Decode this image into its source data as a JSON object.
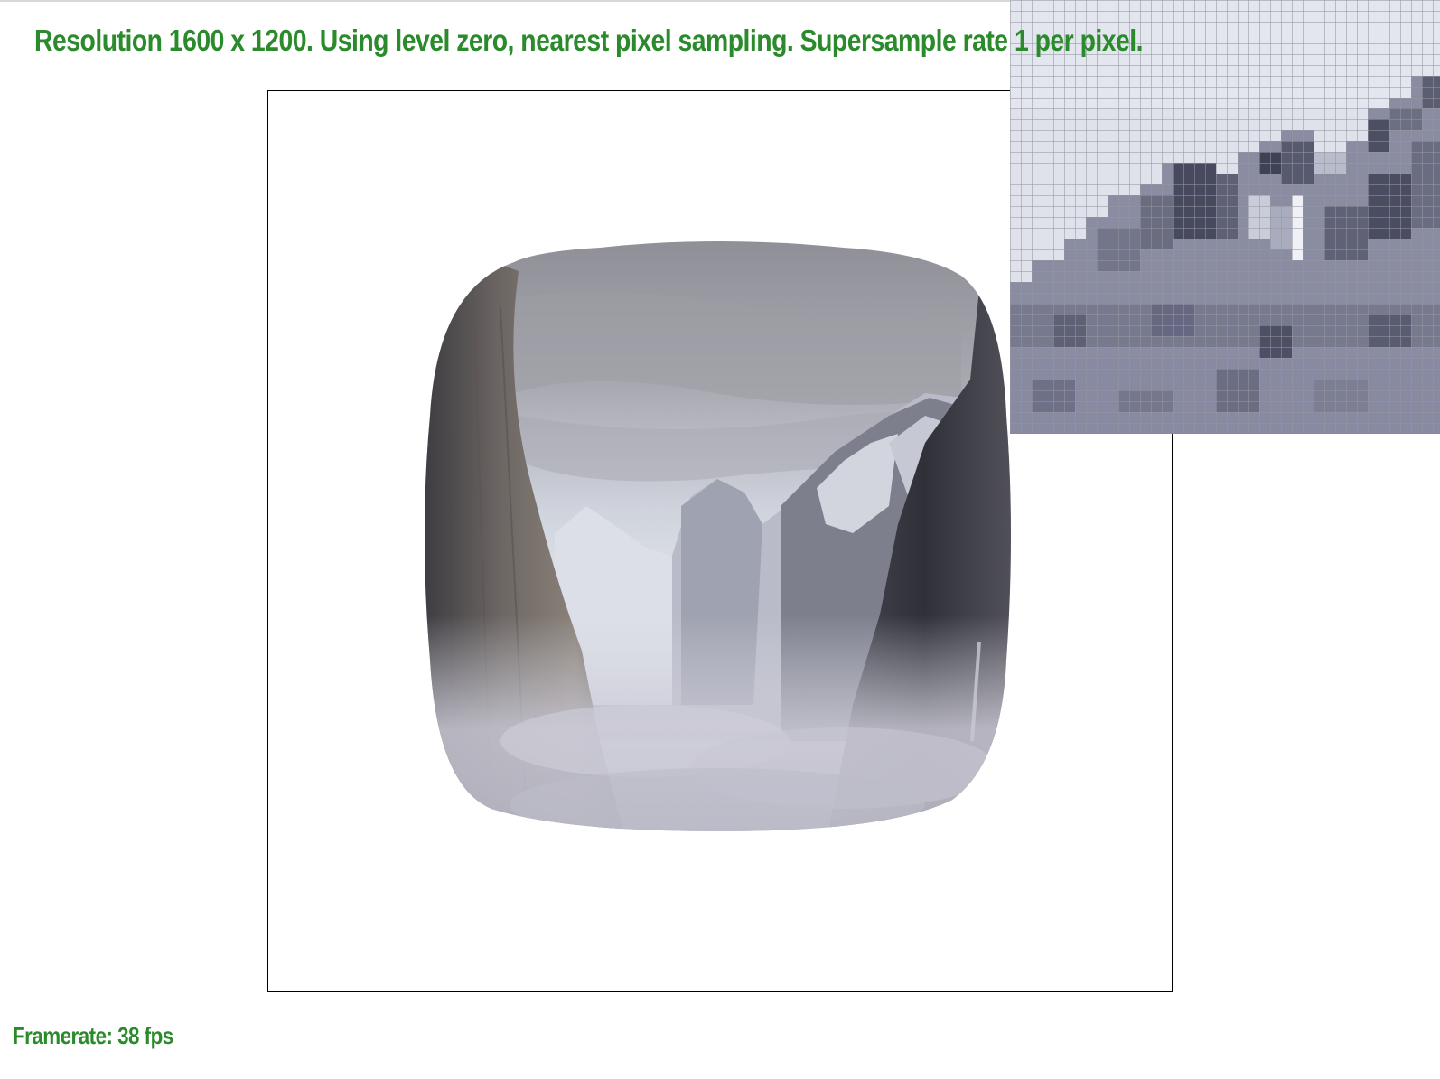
{
  "status": {
    "resolution_line": "Resolution 1600 x 1200. Using level zero, nearest pixel sampling. Supersample rate 1 per pixel.",
    "framerate_line": "Framerate: 38 fps"
  },
  "colors": {
    "status_text": "#2b8a2b",
    "canvas_border": "#000000",
    "background": "#ffffff"
  },
  "scene": {
    "texture_subject": "snowy mountain valley with cliffs and mist",
    "magnifier": "pixel-zoom-grid"
  }
}
